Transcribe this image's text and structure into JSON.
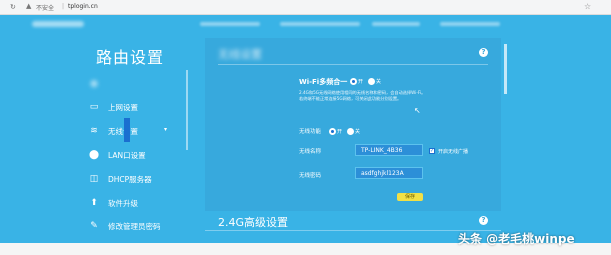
{
  "browser": {
    "insecure_label": "不安全",
    "separator": "|",
    "url": "tplogin.cn",
    "star_icon": "star-icon"
  },
  "sidebar": {
    "title": "路由设置",
    "items": [
      {
        "label": "",
        "icon": "blurred-icon"
      },
      {
        "label": "上网设置",
        "icon": "internet-icon"
      },
      {
        "label": "无线设置",
        "icon": "wifi-icon"
      },
      {
        "label": "LAN口设置",
        "icon": "lan-icon"
      },
      {
        "label": "DHCP服务器",
        "icon": "dhcp-icon"
      },
      {
        "label": "软件升级",
        "icon": "upgrade-icon"
      },
      {
        "label": "修改管理员密码",
        "icon": "password-icon"
      }
    ]
  },
  "main": {
    "panel_title": "无线设置",
    "wifi_multi": {
      "title": "Wi-Fi多频合一",
      "on_label": "开",
      "off_label": "关",
      "description_line1": "2.4G和5G无线网络使用相同的无线名称和密码，会自动选择Wi-Fi。",
      "description_line2": "若终端不能正常连接5G网络，可关闭此功能分别设置。"
    },
    "wireless_function": {
      "label": "无线功能",
      "on_label": "开",
      "off_label": "关"
    },
    "ssid": {
      "label": "无线名称",
      "value": "TP-LINK_4B36"
    },
    "hide_ssid": {
      "label": "开启无线广播",
      "checked": true
    },
    "password": {
      "label": "无线密码",
      "value": "asdfghjkl123A"
    },
    "save_label": "保存",
    "section2_title": "2.4G高级设置"
  },
  "watermark": "头条 @老毛桃winpe",
  "colors": {
    "background": "#39b3e6",
    "accent": "#1a6fd0",
    "save_button": "#f1e046"
  }
}
